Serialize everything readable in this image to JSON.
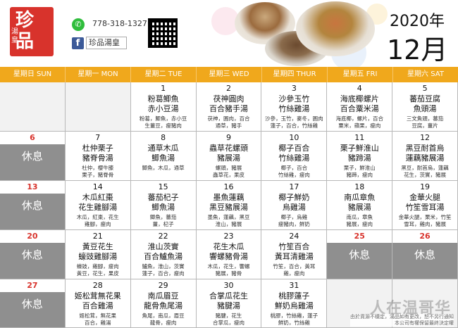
{
  "header": {
    "logo_big1": "珍",
    "logo_big2": "品",
    "logo_small": "湯皇",
    "phone": "778-318-1327",
    "facebook_label": "珍品湯皇",
    "year_label": "2020年",
    "month_label": "12月"
  },
  "days_of_week": [
    "星期日 SUN",
    "星期一 MON",
    "星期二 TUE",
    "星期三 WED",
    "星期四 THUR",
    "星期五 FRI",
    "星期六 SAT"
  ],
  "weeks": [
    [
      {
        "num": "",
        "empty": true
      },
      {
        "num": "1",
        "title": "粉葛鯽魚\n赤小豆湯",
        "desc": "粉葛，鯽魚，赤小豆\n生薑豆，瘦豬肉"
      },
      {
        "num": "2",
        "title": "茯神圓肉\n百合豬手湯",
        "desc": "茯神，圓肉，百合\n通草，豬手"
      },
      {
        "num": "3",
        "title": "沙參玉竹\n竹絲雞湯",
        "desc": "沙參，玉竹，麥冬，圓肉\n蓮子，百合，竹絲雞"
      },
      {
        "num": "4",
        "title": "海底椰螺片\n百合粟米湯",
        "desc": "海底椰，螺片，百合\n粟米，蘋果，瘦肉"
      },
      {
        "num": "5",
        "title": "蕃茄豆腐\n魚頭湯",
        "desc": "三文魚頭，蕃茄\n豆腐，薑片"
      }
    ],
    [
      {
        "num": "6",
        "red": true,
        "rest": "休息"
      },
      {
        "num": "7",
        "title": "杜仲栗子\n豬脊骨湯",
        "desc": "杜仲，櫻牛膝\n栗子，豬脊骨"
      },
      {
        "num": "8",
        "title": "通草木瓜\n鯽魚湯",
        "desc": "鯽魚，木瓜，通草"
      },
      {
        "num": "9",
        "title": "蟲草花螺頭\n豬展湯",
        "desc": "螺頭，豬展\n蟲草花，果皮"
      },
      {
        "num": "10",
        "title": "椰子百合\n竹絲雞湯",
        "desc": "椰子，百合\n竹絲雞，瘦肉"
      },
      {
        "num": "11",
        "title": "栗子鮮淮山\n豬蹄湯",
        "desc": "栗子，鮮淮山\n豬蹄，瘦肉"
      },
      {
        "num": "12",
        "title": "黑豆耐首烏\n蓮藕豬展湯",
        "desc": "黑豆，耐首烏，蓮藕\n花生，茨實，豬展"
      }
    ],
    [
      {
        "num": "13",
        "red": true,
        "rest": "休息"
      },
      {
        "num": "14",
        "title": "木瓜紅棗\n花生雞腳湯",
        "desc": "木瓜，紅棗，花生\n雞腳，瘦肉"
      },
      {
        "num": "15",
        "title": "蕃茄杞子\n鯽魚湯",
        "desc": "鯽魚，蕃茄\n薑，杞子"
      },
      {
        "num": "16",
        "title": "墨魚蓮藕\n黑豆豬展湯",
        "desc": "墨魚，蓮藕，黑豆\n淮山，豬展"
      },
      {
        "num": "17",
        "title": "椰子鮮奶\n烏雞湯",
        "desc": "椰子，烏雞\n瘦豬肉，鮮奶"
      },
      {
        "num": "18",
        "title": "南瓜章魚\n豬展湯",
        "desc": "南瓜，章魚\n豬展，瘦肉"
      },
      {
        "num": "19",
        "title": "金華火腿\n竹笙雪耳湯",
        "desc": "金華火腿，栗米，竹笙\n雪耳，雞肉，豬展"
      }
    ],
    [
      {
        "num": "20",
        "red": true,
        "rest": "休息"
      },
      {
        "num": "21",
        "title": "黃豆花生\n蠔豉雞腳湯",
        "desc": "蠔豉，雞腳，瘦肉\n黃豆，花生，果皮"
      },
      {
        "num": "22",
        "title": "淮山茨實\n百合鱸魚湯",
        "desc": "鱸魚，淮山，茨實\n蓮子，百合，瘦肉"
      },
      {
        "num": "23",
        "title": "花生木瓜\n響螺豬骨湯",
        "desc": "木瓜，花生，響螺\n豬展，豬骨"
      },
      {
        "num": "24",
        "title": "竹笙百合\n黃耳清雞湯",
        "desc": "竹笙，百合，黃耳\n雞，瘦肉"
      },
      {
        "num": "25",
        "red": true,
        "rest": "休息"
      },
      {
        "num": "26",
        "red": true,
        "rest": "休息"
      }
    ],
    [
      {
        "num": "27",
        "red": true,
        "rest": "休息"
      },
      {
        "num": "28",
        "title": "姬松茸無花果\n百合雞湯",
        "desc": "姬松茸，無花果\n百合，雞湯"
      },
      {
        "num": "29",
        "title": "南瓜眉豆\n龍骨魚尾湯",
        "desc": "魚尾，南瓜，眉豆\n龍骨，瘦肉"
      },
      {
        "num": "30",
        "title": "合掌瓜花生\n豬腱湯",
        "desc": "豬腱，花生\n合掌瓜，瘦肉"
      },
      {
        "num": "31",
        "title": "桃膠蓮子\n鮮奶烏雞湯",
        "desc": "桃膠，竹絲雞，蓮子\n鮮奶，竹絲雞"
      },
      {
        "num": "",
        "empty": true
      },
      {
        "num": "",
        "empty": true
      }
    ]
  ],
  "footer_note": "由於貨源不穩定，湯品如有更改，恕不另行通知\n本公司有權保留最終決定權",
  "watermark": "人在温哥华"
}
